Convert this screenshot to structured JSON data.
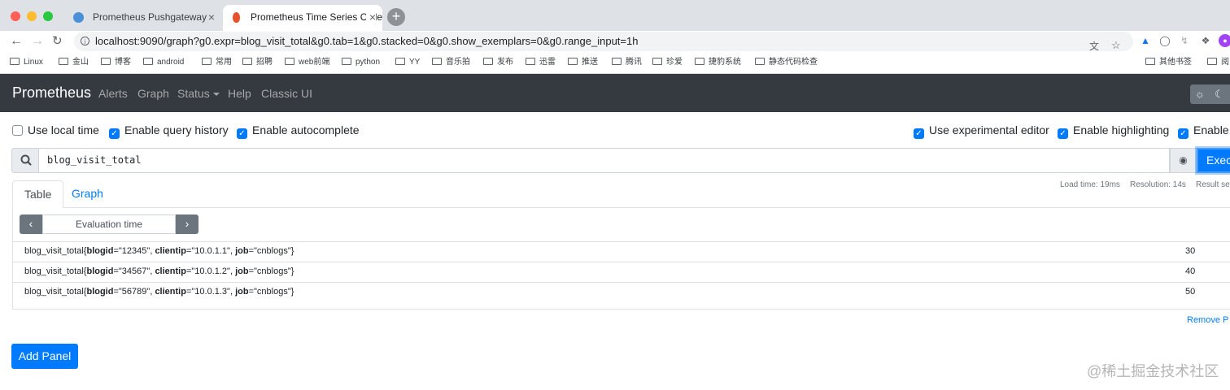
{
  "browser": {
    "tabs": [
      {
        "title": "Prometheus Pushgateway",
        "active": false
      },
      {
        "title": "Prometheus Time Series Collec",
        "active": true
      }
    ],
    "close_glyph": "×",
    "new_tab_glyph": "+",
    "url": "localhost:9090/graph?g0.expr=blog_visit_total&g0.tab=1&g0.stacked=0&g0.show_exemplars=0&g0.range_input=1h",
    "bookmarks": [
      "Linux",
      "金山",
      "博客",
      "android",
      "常用",
      "招聘",
      "web前端",
      "python",
      "YY",
      "音乐拍",
      "发布",
      "迅雷",
      "推送",
      "腾讯",
      "珍爱",
      "捷豹系统",
      "静态代码检查"
    ],
    "bookmarks_right": [
      "其他书签",
      "阅"
    ]
  },
  "nav": {
    "brand": "Prometheus",
    "links": [
      "Alerts",
      "Graph",
      "Status",
      "Help",
      "Classic UI"
    ]
  },
  "options": {
    "use_local_time": {
      "label": "Use local time",
      "checked": false
    },
    "enable_query_history": {
      "label": "Enable query history",
      "checked": true
    },
    "enable_autocomplete": {
      "label": "Enable autocomplete",
      "checked": true
    },
    "use_experimental_editor": {
      "label": "Use experimental editor",
      "checked": true
    },
    "enable_highlighting": {
      "label": "Enable highlighting",
      "checked": true
    },
    "enable_linter": {
      "label": "Enable",
      "checked": true
    }
  },
  "query": {
    "expression": "blog_visit_total",
    "execute_label": "Exec"
  },
  "panel": {
    "tabs": [
      "Table",
      "Graph"
    ],
    "active_tab": "Table",
    "stats": {
      "load_time": "Load time: 19ms",
      "resolution": "Resolution: 14s",
      "result_series": "Result se"
    },
    "eval_time_placeholder": "Evaluation time",
    "prev_glyph": "‹",
    "next_glyph": "›",
    "rows": [
      {
        "metric": "blog_visit_total",
        "labels": [
          {
            "k": "blogid",
            "v": "\"12345\""
          },
          {
            "k": "clientip",
            "v": "\"10.0.1.1\""
          },
          {
            "k": "job",
            "v": "\"cnblogs\""
          }
        ],
        "value": "30"
      },
      {
        "metric": "blog_visit_total",
        "labels": [
          {
            "k": "blogid",
            "v": "\"34567\""
          },
          {
            "k": "clientip",
            "v": "\"10.0.1.2\""
          },
          {
            "k": "job",
            "v": "\"cnblogs\""
          }
        ],
        "value": "40"
      },
      {
        "metric": "blog_visit_total",
        "labels": [
          {
            "k": "blogid",
            "v": "\"56789\""
          },
          {
            "k": "clientip",
            "v": "\"10.0.1.3\""
          },
          {
            "k": "job",
            "v": "\"cnblogs\""
          }
        ],
        "value": "50"
      }
    ],
    "remove_label": "Remove P"
  },
  "add_panel_label": "Add Panel",
  "watermark": "@稀土掘金技术社区",
  "colors": {
    "primary": "#007bff",
    "navbar": "#343a40",
    "muted": "#6c757d"
  }
}
